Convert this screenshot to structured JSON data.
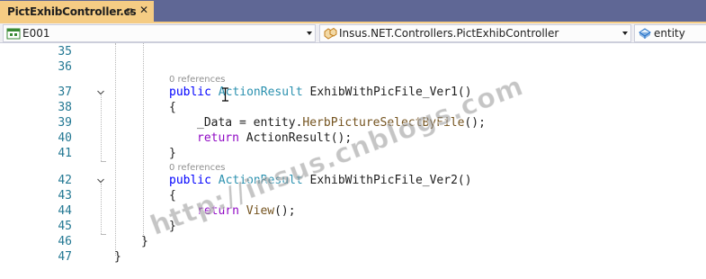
{
  "tab": {
    "title": "PictExhibController.cs",
    "pin_icon": "pin-icon",
    "close_label": "✕"
  },
  "navbar": {
    "project": "E001",
    "type": "Insus.NET.Controllers.PictExhibController",
    "member": "entity"
  },
  "editor": {
    "codelens_1": "0 references",
    "codelens_2": "0 references",
    "lines": [
      {
        "num": "35"
      },
      {
        "num": "36"
      },
      {
        "num": "37",
        "kw": "public",
        "type": "ActionResult",
        "rest": " ExhibWithPicFile_Ver1()"
      },
      {
        "num": "38",
        "text": "{"
      },
      {
        "num": "39",
        "pre": "_Data = entity.",
        "method": "HerbPictureSelectByFile",
        "post": "();"
      },
      {
        "num": "40",
        "kw": "return",
        "rest": " ActionResult();"
      },
      {
        "num": "41",
        "text": "}"
      },
      {
        "num": "42",
        "kw": "public",
        "type": "ActionResult",
        "rest": " ExhibWithPicFile_Ver2()"
      },
      {
        "num": "43",
        "text": "{"
      },
      {
        "num": "44",
        "kw": "return",
        "method": "View",
        "post": "();"
      },
      {
        "num": "45",
        "text": "}"
      },
      {
        "num": "46",
        "text": "}"
      },
      {
        "num": "47",
        "text": "}"
      }
    ]
  },
  "watermark": "http://insus.cnblogs.com",
  "colors": {
    "tab_strip": "#5f6795",
    "active_tab": "#f5cc84",
    "keyword": "#0000ff",
    "control_keyword": "#8f08c4",
    "type_name": "#2b91af",
    "method_name": "#74531f",
    "line_number": "#237893"
  }
}
